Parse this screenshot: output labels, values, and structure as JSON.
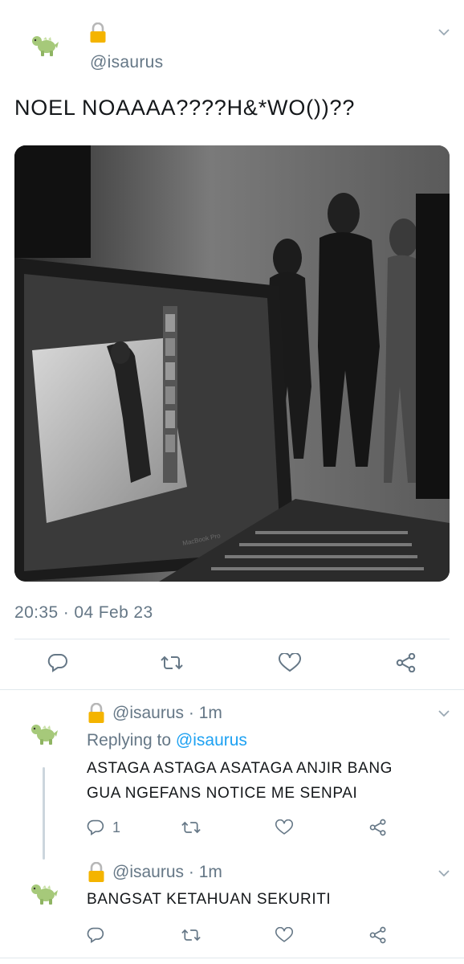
{
  "tweet": {
    "handle": "@isaurus",
    "text": "NOEL NOAAAA????H&*WO())??",
    "timestamp": "20:35 · 04 Feb 23",
    "photo_screen_label": "MacBook Pro"
  },
  "replies": [
    {
      "handle": "@isaurus",
      "sep": "·",
      "time": "1m",
      "replying_prefix": "Replying to",
      "replying_handle": "@isaurus",
      "text_line1": "ASTAGA ASTAGA ASATAGA ANJIR BANG",
      "text_line2": "GUA NGEFANS NOTICE ME SENPAI",
      "reply_count": "1"
    },
    {
      "handle": "@isaurus",
      "sep": "·",
      "time": "1m",
      "text_line1": "BANGSAT KETAHUAN SEKURITI"
    }
  ],
  "icons": {
    "avatar": "dinosaur-avatar-icon",
    "lock": "lock-icon",
    "chevron": "chevron-down-icon",
    "reply": "reply-icon",
    "retweet": "retweet-icon",
    "like": "heart-icon",
    "share": "share-icon"
  },
  "colors": {
    "handle_gray": "#657786",
    "link_blue": "#1da1f2",
    "lock_gold": "#f4b400",
    "icon_gray": "#657786",
    "divider": "#e1e8ed"
  }
}
